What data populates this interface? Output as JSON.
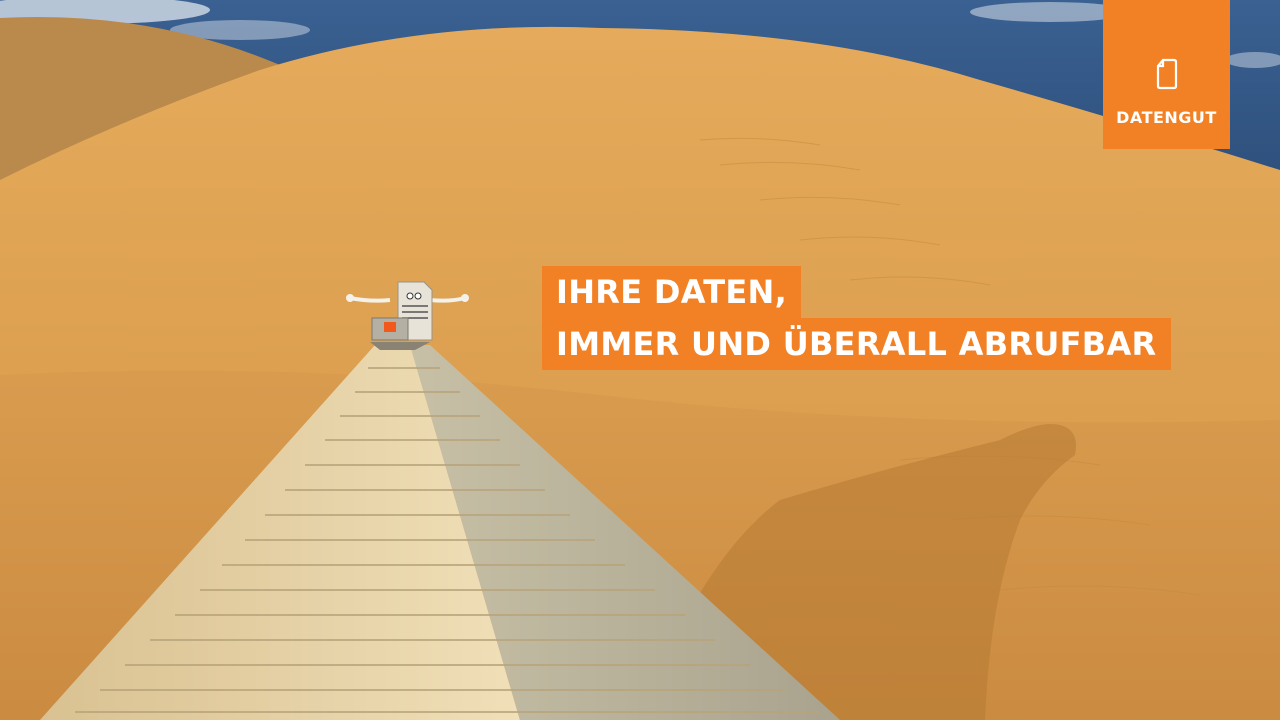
{
  "logo": {
    "brand": "DATENGUT",
    "icon": "document-icon"
  },
  "headline": {
    "line1": "IHRE DATEN,",
    "line2": "IMMER UND ÜBERALL ABRUFBAR"
  },
  "colors": {
    "accent": "#f28125",
    "sky": "#3f6a9c",
    "sand": "#e0a552",
    "pyramid": "#e6d2a6"
  }
}
